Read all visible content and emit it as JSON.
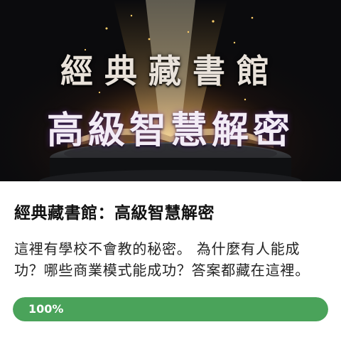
{
  "banner": {
    "title": "經典藏書館",
    "subtitle": "高級智慧解密",
    "icon": "open-book-image"
  },
  "course": {
    "title": "經典藏書館：高級智慧解密",
    "description": "這裡有學校不會教的秘密。 為什麼有人能成功？哪些商業模式能成功？答案都藏在這裡。"
  },
  "progress": {
    "value": 1.0,
    "label": "100%",
    "color": "#4aa35a"
  }
}
